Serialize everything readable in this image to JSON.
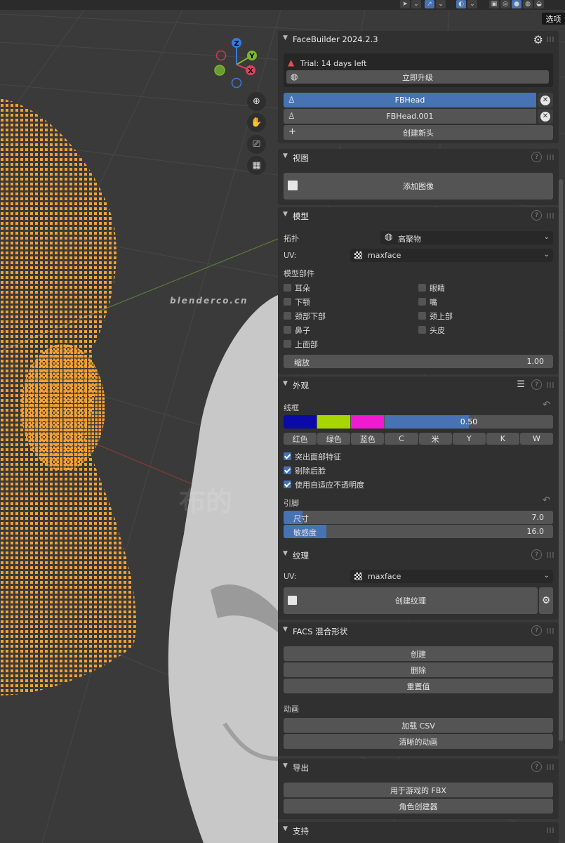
{
  "tooltip": "选项",
  "watermark": {
    "url": "blenderco.cn",
    "big": "布的"
  },
  "header": {
    "title": "FaceBuilder 2024.2.3"
  },
  "trial": {
    "text": "Trial: 14 days left",
    "upgrade": "立即升级"
  },
  "heads": [
    {
      "name": "FBHead",
      "active": true
    },
    {
      "name": "FBHead.001",
      "active": false
    }
  ],
  "create_head": "创建新头",
  "views": {
    "title": "视图",
    "add_image": "添加图像"
  },
  "model": {
    "title": "模型",
    "topology_label": "拓扑",
    "topology_value": "高聚物",
    "uv_label": "UV:",
    "uv_value": "maxface",
    "parts_label": "模型部件",
    "parts_left": [
      "耳朵",
      "下颚",
      "颈部下部",
      "鼻子",
      "上面部"
    ],
    "parts_right": [
      "眼睛",
      "嘴",
      "颈上部",
      "头皮"
    ],
    "scale_label": "缩放",
    "scale_value": "1.00"
  },
  "appearance": {
    "title": "外观",
    "wireframe_label": "线框",
    "opacity_value": "0.50",
    "opacity_fraction": 0.5,
    "colors": {
      "c1": "#0a0aa8",
      "c2": "#a8d600",
      "c3": "#f01ad0",
      "c4": "#4772b3"
    },
    "color_buttons": [
      "红色",
      "绿色",
      "蓝色",
      "C",
      "米",
      "Y",
      "K",
      "W"
    ],
    "checks": [
      {
        "label": "突出面部特征",
        "on": true
      },
      {
        "label": "剔除后脸",
        "on": true
      },
      {
        "label": "使用自适应不透明度",
        "on": true
      }
    ],
    "pins_label": "引脚",
    "size_label": "尺寸",
    "size_value": "7.0",
    "size_fraction": 0.07,
    "sens_label": "敏感度",
    "sens_value": "16.0",
    "sens_fraction": 0.16
  },
  "texture": {
    "title": "纹理",
    "uv_label": "UV:",
    "uv_value": "maxface",
    "create": "创建纹理"
  },
  "facs": {
    "title": "FACS 混合形状",
    "create": "创建",
    "delete": "删除",
    "reset": "重置值",
    "anim_label": "动画",
    "load_csv": "加载 CSV",
    "clear_anim": "清晰的动画"
  },
  "export": {
    "title": "导出",
    "fbx": "用于游戏的 FBX",
    "char_creator": "角色创建器"
  },
  "support": {
    "title": "支持"
  },
  "gizmo": {
    "z": "Z",
    "y": "Y",
    "x": "X"
  }
}
